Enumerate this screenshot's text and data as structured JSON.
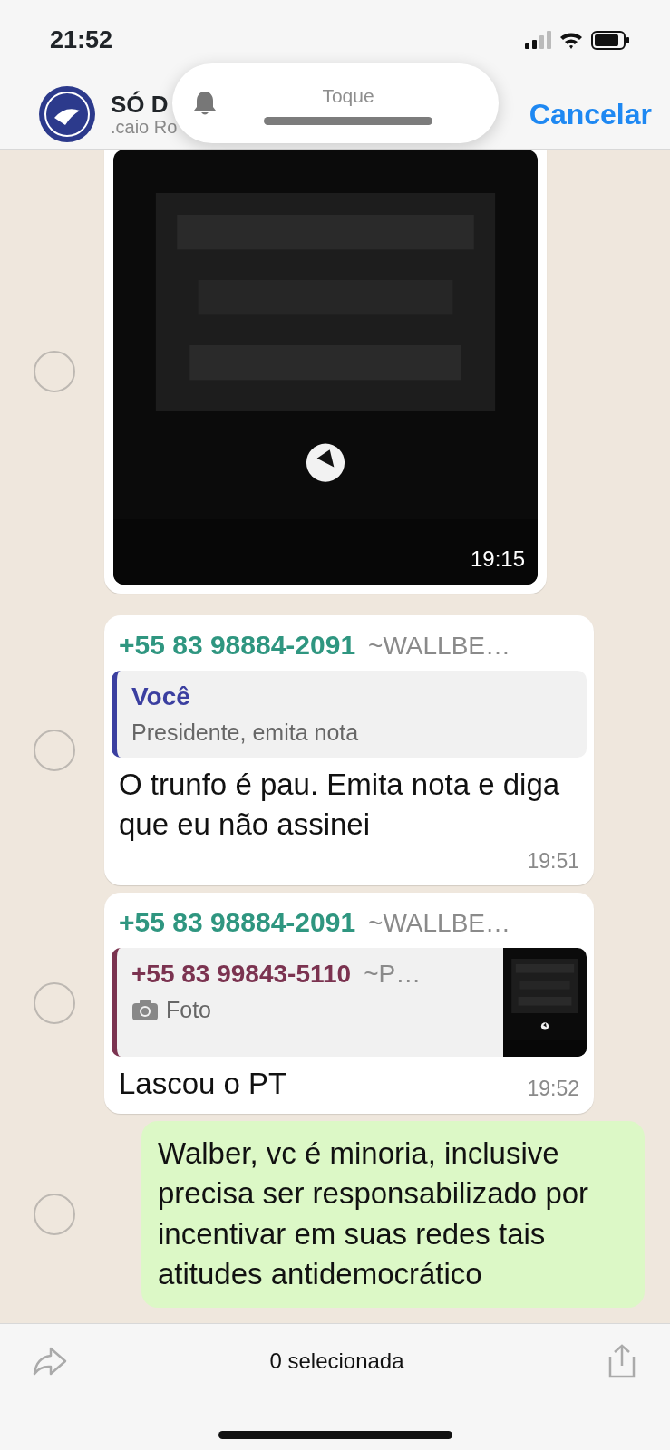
{
  "status_bar": {
    "time": "21:52"
  },
  "header": {
    "group_name": "SÓ D",
    "subtitle": ".caio Ro",
    "cancel": "Cancelar"
  },
  "banner": {
    "label": "Toque"
  },
  "messages": [
    {
      "time": "19:15",
      "selected": false
    },
    {
      "kind": "reply",
      "sender": "+55 83 98884-2091",
      "sender_name": "~WALLBE…",
      "quote": {
        "author": "Você",
        "text": "Presidente, emita nota",
        "color": "#3b3fa0"
      },
      "text": "O trunfo é pau. Emita nota e diga que eu não assinei",
      "time": "19:51",
      "selected": false
    },
    {
      "kind": "reply",
      "sender": "+55 83 98884-2091",
      "sender_name": "~WALLBE…",
      "quote": {
        "author": "+55 83 99843-5110",
        "author_name": "~P…",
        "text": "Foto",
        "photo": true,
        "color": "#7b3350"
      },
      "text": "Lascou o PT",
      "time": "19:52",
      "selected": false
    },
    {
      "kind": "outgoing",
      "text": "Walber, vc é minoria, inclusive precisa ser responsabilizado por incentivar em suas redes tais atitudes antidemocrático",
      "selected": false
    }
  ],
  "footer": {
    "count": "0 selecionada"
  }
}
